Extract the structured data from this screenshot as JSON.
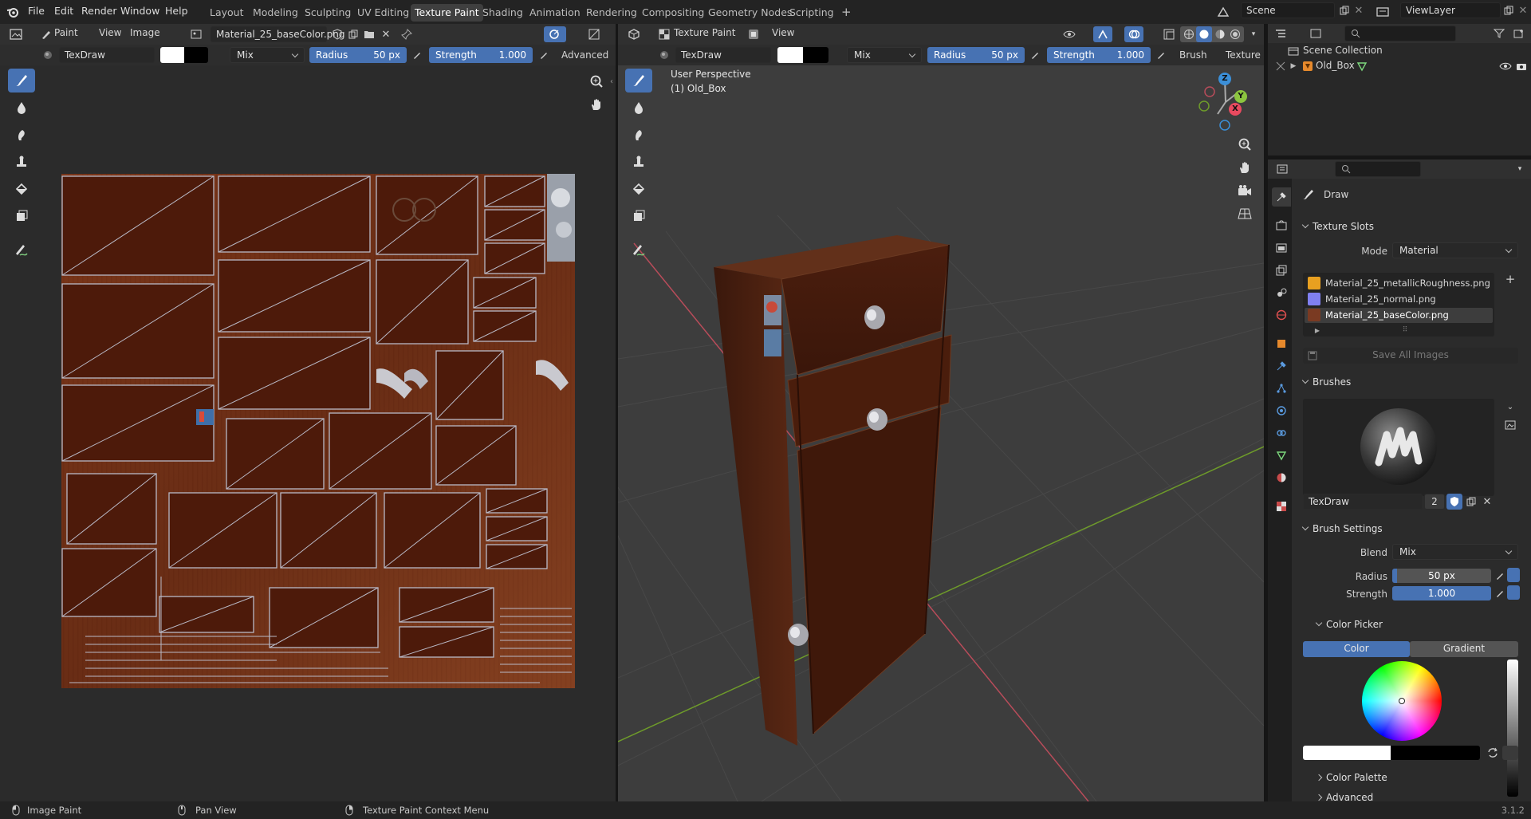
{
  "topbar": {
    "menus": [
      "File",
      "Edit",
      "Render",
      "Window",
      "Help"
    ],
    "workspaces": [
      "Layout",
      "Modeling",
      "Sculpting",
      "UV Editing",
      "Texture Paint",
      "Shading",
      "Animation",
      "Rendering",
      "Compositing",
      "Geometry Nodes",
      "Scripting"
    ],
    "active_workspace": "Texture Paint",
    "add_workspace": "+",
    "scene": "Scene",
    "view_layer": "ViewLayer"
  },
  "image_editor": {
    "mode": "Paint",
    "menus": [
      "View",
      "Image"
    ],
    "image_name": "Material_25_baseColor.png",
    "tool": {
      "brush": "TexDraw",
      "blend": "Mix",
      "radius_label": "Radius",
      "radius_value": "50 px",
      "strength_label": "Strength",
      "strength_value": "1.000",
      "advanced": "Advanced"
    }
  },
  "viewport": {
    "mode": "Texture Paint",
    "menus": [
      "View"
    ],
    "tool": {
      "brush": "TexDraw",
      "blend": "Mix",
      "radius_label": "Radius",
      "radius_value": "50 px",
      "strength_label": "Strength",
      "strength_value": "1.000",
      "brush_menu": "Brush",
      "texture_menu": "Texture"
    },
    "perspective": "User Perspective",
    "object": "(1) Old_Box",
    "gizmo": {
      "z": "Z",
      "y": "Y",
      "x": "X"
    }
  },
  "outliner": {
    "root": "Scene Collection",
    "items": [
      {
        "name": "Old_Box"
      }
    ]
  },
  "properties": {
    "tool_name": "Draw",
    "texture_slots": {
      "title": "Texture Slots",
      "mode_label": "Mode",
      "mode_value": "Material",
      "slots": [
        {
          "name": "Material_25_metallicRoughness.png",
          "color": "#e8a020"
        },
        {
          "name": "Material_25_normal.png",
          "color": "#8080f0"
        },
        {
          "name": "Material_25_baseColor.png",
          "color": "#7a3a22"
        }
      ],
      "save_all": "Save All Images"
    },
    "brushes": {
      "title": "Brushes",
      "brush_name": "TexDraw",
      "users": "2"
    },
    "brush_settings": {
      "title": "Brush Settings",
      "blend_label": "Blend",
      "blend_value": "Mix",
      "radius_label": "Radius",
      "radius_value": "50 px",
      "strength_label": "Strength",
      "strength_value": "1.000"
    },
    "color_picker": {
      "title": "Color Picker",
      "tabs": [
        "Color",
        "Gradient"
      ],
      "active_tab": "Color",
      "primary_color": "#ffffff",
      "secondary_color": "#000000"
    },
    "color_palette": "Color Palette",
    "advanced": "Advanced"
  },
  "statusbar": {
    "left": "Image Paint",
    "middle": "Pan View",
    "right": "Texture Paint Context Menu",
    "version": "3.1.2"
  },
  "colors": {
    "accent": "#4772b3",
    "axis_x": "#e84a5f",
    "axis_y": "#8cc63f",
    "axis_z": "#3b8fd8"
  }
}
